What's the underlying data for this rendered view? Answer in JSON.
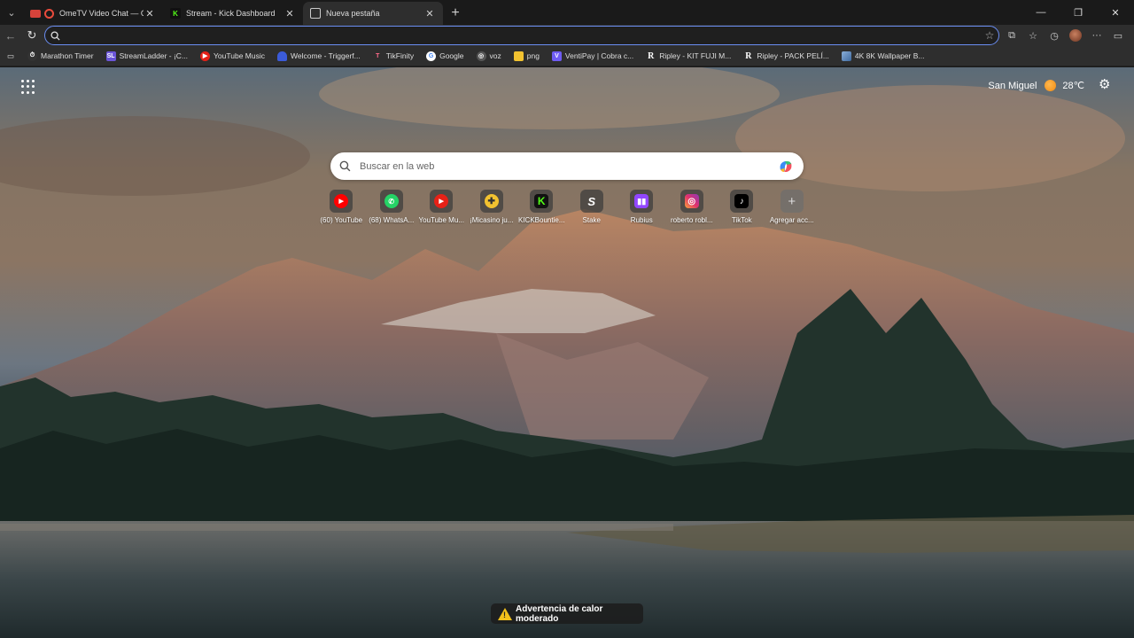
{
  "tabs": [
    {
      "title": "OmeTV Video Chat — Omegle",
      "favicon": "ometv-icon",
      "active": false
    },
    {
      "title": "Stream - Kick Dashboard",
      "favicon": "kick-icon",
      "active": false
    },
    {
      "title": "Nueva pestaña",
      "favicon": "newtab-icon",
      "active": true
    }
  ],
  "omnibox": {
    "value": "",
    "placeholder": ""
  },
  "bookmarks": [
    {
      "label": "Marathon Timer",
      "icon": "timer-icon",
      "color": "#444444"
    },
    {
      "label": "StreamLadder - ¡C...",
      "icon": "streamladder-icon",
      "color": "#6b55d8",
      "glyph": "SL"
    },
    {
      "label": "YouTube Music",
      "icon": "youtube-music-icon",
      "color": "#e62117"
    },
    {
      "label": "Welcome - Triggerf...",
      "icon": "triggerfyre-icon",
      "color": "#3b5bd9"
    },
    {
      "label": "TikFinity",
      "icon": "tikfinity-icon",
      "color": "#ff4d6d",
      "glyph": "T"
    },
    {
      "label": "Google",
      "icon": "google-icon",
      "color": "#ffffff",
      "glyph": "G"
    },
    {
      "label": "voz",
      "icon": "globe-icon",
      "color": "#555555"
    },
    {
      "label": "png",
      "icon": "folder-icon",
      "color": "#f2c230"
    },
    {
      "label": "VentiPay | Cobra c...",
      "icon": "ventipay-icon",
      "color": "#6f5cf2",
      "glyph": "V"
    },
    {
      "label": "Ripley - KIT FUJI M...",
      "icon": "ripley-icon",
      "color": "#222222",
      "glyph": "R"
    },
    {
      "label": "Ripley - PACK PELÍ...",
      "icon": "ripley-icon",
      "color": "#222222",
      "glyph": "R"
    },
    {
      "label": "4K 8K Wallpaper B...",
      "icon": "wallpaper-icon",
      "color": "#8aaed8"
    }
  ],
  "weather": {
    "location": "San Miguel",
    "temp": "28℃"
  },
  "search": {
    "placeholder": "Buscar en la web"
  },
  "quick_links": [
    {
      "label": "(60) YouTube",
      "icon": "youtube-icon",
      "color": "#ff0000"
    },
    {
      "label": "(68) WhatsA...",
      "icon": "whatsapp-icon",
      "color": "#25d366"
    },
    {
      "label": "YouTube Mu...",
      "icon": "youtube-music-icon",
      "color": "#e62117"
    },
    {
      "label": "¡Micasino ju...",
      "icon": "micasino-icon",
      "color": "#f2c230"
    },
    {
      "label": "KICKBountie...",
      "icon": "kick-icon",
      "color": "#53fc18"
    },
    {
      "label": "Stake",
      "icon": "stake-icon",
      "color": "#1a2c38"
    },
    {
      "label": "Rubius",
      "icon": "twitch-icon",
      "color": "#9146ff"
    },
    {
      "label": "roberto robl...",
      "icon": "instagram-icon",
      "color": "#e1306c"
    },
    {
      "label": "TikTok",
      "icon": "tiktok-icon",
      "color": "#000000"
    },
    {
      "label": "Agregar acc...",
      "icon": "plus-icon",
      "color": "#6a6a6a"
    }
  ],
  "alert": {
    "text": "Advertencia de calor moderado"
  }
}
